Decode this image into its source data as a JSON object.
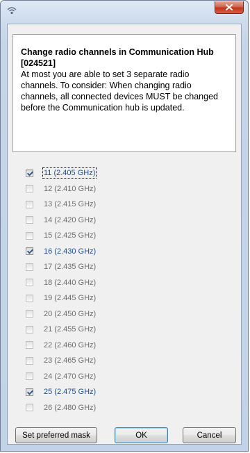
{
  "window": {
    "title": ""
  },
  "info": {
    "title": "Change radio channels in Communication Hub [024521]",
    "body": "At most you are able to set 3 separate radio channels. To consider: When changing radio channels, all connected devices MUST be changed before the Communication hub is updated."
  },
  "channels": [
    {
      "label": "11 (2.405 GHz)",
      "checked": true
    },
    {
      "label": "12 (2.410 GHz)",
      "checked": false
    },
    {
      "label": "13 (2.415 GHz)",
      "checked": false
    },
    {
      "label": "14 (2.420 GHz)",
      "checked": false
    },
    {
      "label": "15 (2.425 GHz)",
      "checked": false
    },
    {
      "label": "16 (2.430 GHz)",
      "checked": true
    },
    {
      "label": "17 (2.435 GHz)",
      "checked": false
    },
    {
      "label": "18 (2.440 GHz)",
      "checked": false
    },
    {
      "label": "19 (2.445 GHz)",
      "checked": false
    },
    {
      "label": "20 (2.450 GHz)",
      "checked": false
    },
    {
      "label": "21 (2.455 GHz)",
      "checked": false
    },
    {
      "label": "22 (2.460 GHz)",
      "checked": false
    },
    {
      "label": "23 (2.465 GHz)",
      "checked": false
    },
    {
      "label": "24 (2.470 GHz)",
      "checked": false
    },
    {
      "label": "25 (2.475 GHz)",
      "checked": true
    },
    {
      "label": "26 (2.480 GHz)",
      "checked": false
    }
  ],
  "buttons": {
    "set_mask_label": "Set preferred mask",
    "ok_label": "OK",
    "cancel_label": "Cancel"
  },
  "icons": {
    "app": "radio-icon",
    "close": "close-icon"
  },
  "colors": {
    "checked_text": "#1d4f91",
    "unchecked_text": "#6d6d6d",
    "close_button": "#c2331b"
  }
}
